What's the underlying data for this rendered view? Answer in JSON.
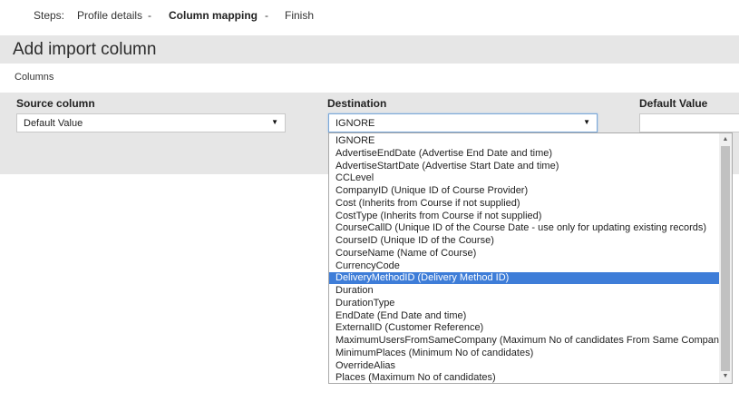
{
  "steps": {
    "label": "Steps:",
    "items": [
      "Profile details",
      "-",
      "Column mapping",
      "-",
      "Finish"
    ]
  },
  "page": {
    "title": "Add import column",
    "section": "Columns"
  },
  "form": {
    "source_label": "Source column",
    "source_value": "Default Value",
    "destination_label": "Destination",
    "destination_value": "IGNORE",
    "default_label": "Default Value",
    "default_input_value": ""
  },
  "dropdown": {
    "options": [
      "IGNORE",
      "AdvertiseEndDate (Advertise End Date and time)",
      "AdvertiseStartDate (Advertise Start Date and time)",
      "CCLevel",
      "CompanyID (Unique ID of Course Provider)",
      "Cost (Inherits from Course if not supplied)",
      "CostType (Inherits from Course if not supplied)",
      "CourseCallD (Unique ID of the Course Date - use only for updating existing records)",
      "CourseID (Unique ID of the Course)",
      "CourseName (Name of Course)",
      "CurrencyCode",
      "DeliveryMethodID (Delivery Method ID)",
      "Duration",
      "DurationType",
      "EndDate (End Date and time)",
      "ExternalID (Customer Reference)",
      "MaximumUsersFromSameCompany (Maximum No of candidates From Same Company)",
      "MinimumPlaces (Minimum No of candidates)",
      "OverrideAlias",
      "Places (Maximum No of candidates)"
    ],
    "highlighted": "DeliveryMethodID (Delivery Method ID)"
  },
  "icons": {
    "select_arrow": "caret-down-icon",
    "scroll_up": "scroll-up-arrow-icon",
    "scroll_down": "scroll-down-arrow-icon"
  },
  "colors": {
    "highlight": "#3e7dd8",
    "panel": "#e6e6e6",
    "focus_border": "#7aa7d8"
  }
}
